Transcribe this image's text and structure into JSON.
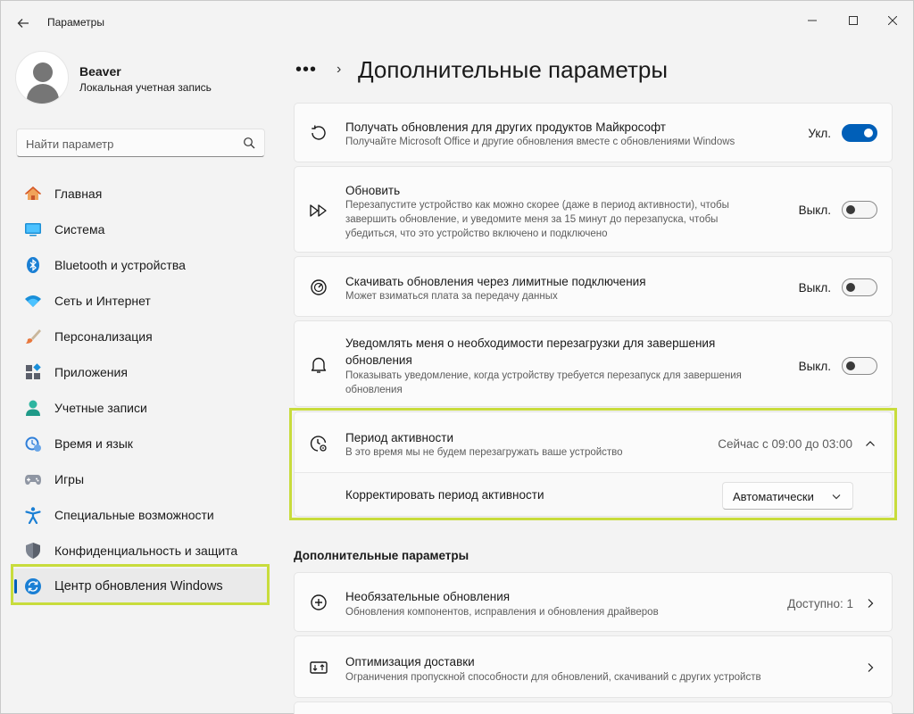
{
  "window": {
    "title": "Параметры"
  },
  "profile": {
    "name": "Beaver",
    "account_type": "Локальная учетная запись"
  },
  "search": {
    "placeholder": "Найти параметр"
  },
  "nav": [
    {
      "label": "Главная",
      "icon": "home-icon"
    },
    {
      "label": "Система",
      "icon": "system-icon"
    },
    {
      "label": "Bluetooth и устройства",
      "icon": "bluetooth-icon"
    },
    {
      "label": "Сеть и Интернет",
      "icon": "wifi-icon"
    },
    {
      "label": "Персонализация",
      "icon": "brush-icon"
    },
    {
      "label": "Приложения",
      "icon": "apps-icon"
    },
    {
      "label": "Учетные записи",
      "icon": "accounts-icon"
    },
    {
      "label": "Время и язык",
      "icon": "time-language-icon"
    },
    {
      "label": "Игры",
      "icon": "gamepad-icon"
    },
    {
      "label": "Специальные возможности",
      "icon": "accessibility-icon"
    },
    {
      "label": "Конфиденциальность и защита",
      "icon": "shield-icon"
    },
    {
      "label": "Центр обновления Windows",
      "icon": "windows-update-icon",
      "active": true
    }
  ],
  "breadcrumb": {
    "ellipsis": "•••",
    "separator": "›",
    "title": "Дополнительные параметры"
  },
  "settings": [
    {
      "title": "Получать обновления для других продуктов Майкрософт",
      "subtitle": "Получайте Microsoft Office и другие обновления вместе с обновлениями Windows",
      "state": "Укл.",
      "on": true,
      "icon": "refresh-history-icon"
    },
    {
      "title": "Обновить",
      "subtitle_lines": [
        "Перезапустите устройство как можно скорее (даже в период активности), чтобы",
        "завершить обновление, и уведомите меня за 15 минут до перезапуска, чтобы",
        "убедиться, что это устройство включено и подключено"
      ],
      "state": "Выкл.",
      "on": false,
      "icon": "fast-forward-icon"
    },
    {
      "title": "Скачивать обновления через лимитные подключения",
      "subtitle": "Может взиматься плата за передачу данных",
      "state": "Выкл.",
      "on": false,
      "icon": "speedometer-icon"
    },
    {
      "title_lines": [
        "Уведомлять меня о необходимости перезагрузки для завершения",
        "обновления"
      ],
      "subtitle_lines": [
        "Показывать уведомление, когда устройству требуется перезапуск для завершения",
        "обновления"
      ],
      "state": "Выкл.",
      "on": false,
      "icon": "bell-icon"
    }
  ],
  "active_hours": {
    "title": "Период активности",
    "subtitle": "В это время мы не будем перезагружать ваше устройство",
    "summary": "Сейчас с 09:00 до 03:00",
    "adjust_label": "Корректировать период активности",
    "adjust_value": "Автоматически",
    "icon": "clock-gear-icon"
  },
  "more_section": {
    "title": "Дополнительные параметры",
    "items": [
      {
        "title": "Необязательные обновления",
        "subtitle": "Обновления компонентов, исправления и обновления драйверов",
        "badge": "Доступно: 1",
        "icon": "plus-circle-icon"
      },
      {
        "title": "Оптимизация доставки",
        "subtitle": "Ограничения пропускной способности для обновлений, скачиваний с других устройств",
        "icon": "delivery-optimization-icon"
      }
    ]
  },
  "colors": {
    "accent": "#005fb8",
    "highlight": "#c8dc3c",
    "background": "#f3f3f3",
    "card": "#fbfbfb"
  }
}
